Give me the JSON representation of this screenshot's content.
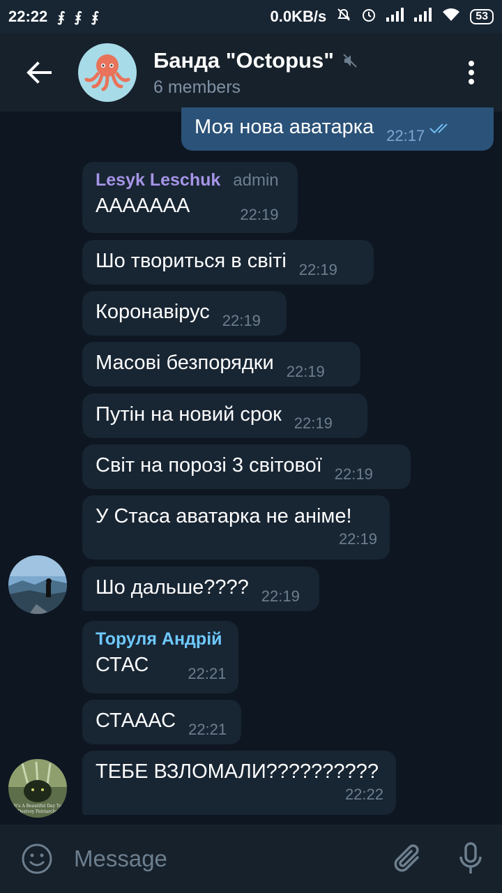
{
  "status_bar": {
    "time": "22:22",
    "notif_glyph": "⨘",
    "net_speed": "0.0KB/s",
    "battery": "53"
  },
  "header": {
    "title": "Банда \"Octopus\"",
    "subtitle": "6 members"
  },
  "colors": {
    "accent_sender_1": "#a695e7",
    "accent_sender_2": "#6ec9ff",
    "bubble_in": "#182533",
    "bubble_out": "#2b5278",
    "background": "#0e1621"
  },
  "messages": [
    {
      "text": "Моя нова аватарка",
      "time": "22:17",
      "outgoing": true
    },
    {
      "sender": "Lesyk Leschuk",
      "role": "admin",
      "text": "AAAAAAA",
      "time": "22:19"
    },
    {
      "text": "Шо твориться в світі",
      "time": "22:19"
    },
    {
      "text": "Коронавірус",
      "time": "22:19"
    },
    {
      "text": "Масові безпорядки",
      "time": "22:19"
    },
    {
      "text": "Путін на новий срок",
      "time": "22:19"
    },
    {
      "text": "Світ на порозі 3 світової",
      "time": "22:19"
    },
    {
      "text": "У Стаса аватарка не аніме!",
      "time": "22:19"
    },
    {
      "text": "Шо дальше????",
      "time": "22:19"
    },
    {
      "sender": "Торуля Андрій",
      "text": "СТАС",
      "time": "22:21"
    },
    {
      "text": "СТАААС",
      "time": "22:21"
    },
    {
      "text": "ТЕБЕ ВЗЛОМАЛИ??????????",
      "time": "22:22"
    }
  ],
  "avatar2_text": "It's A Beautiful Day To Destroy Patriarchy",
  "composer": {
    "placeholder": "Message"
  },
  "icons": [
    "back-arrow-icon",
    "mute-icon",
    "more-vert-icon",
    "emoji-icon",
    "attach-icon",
    "mic-icon",
    "double-check-icon"
  ]
}
